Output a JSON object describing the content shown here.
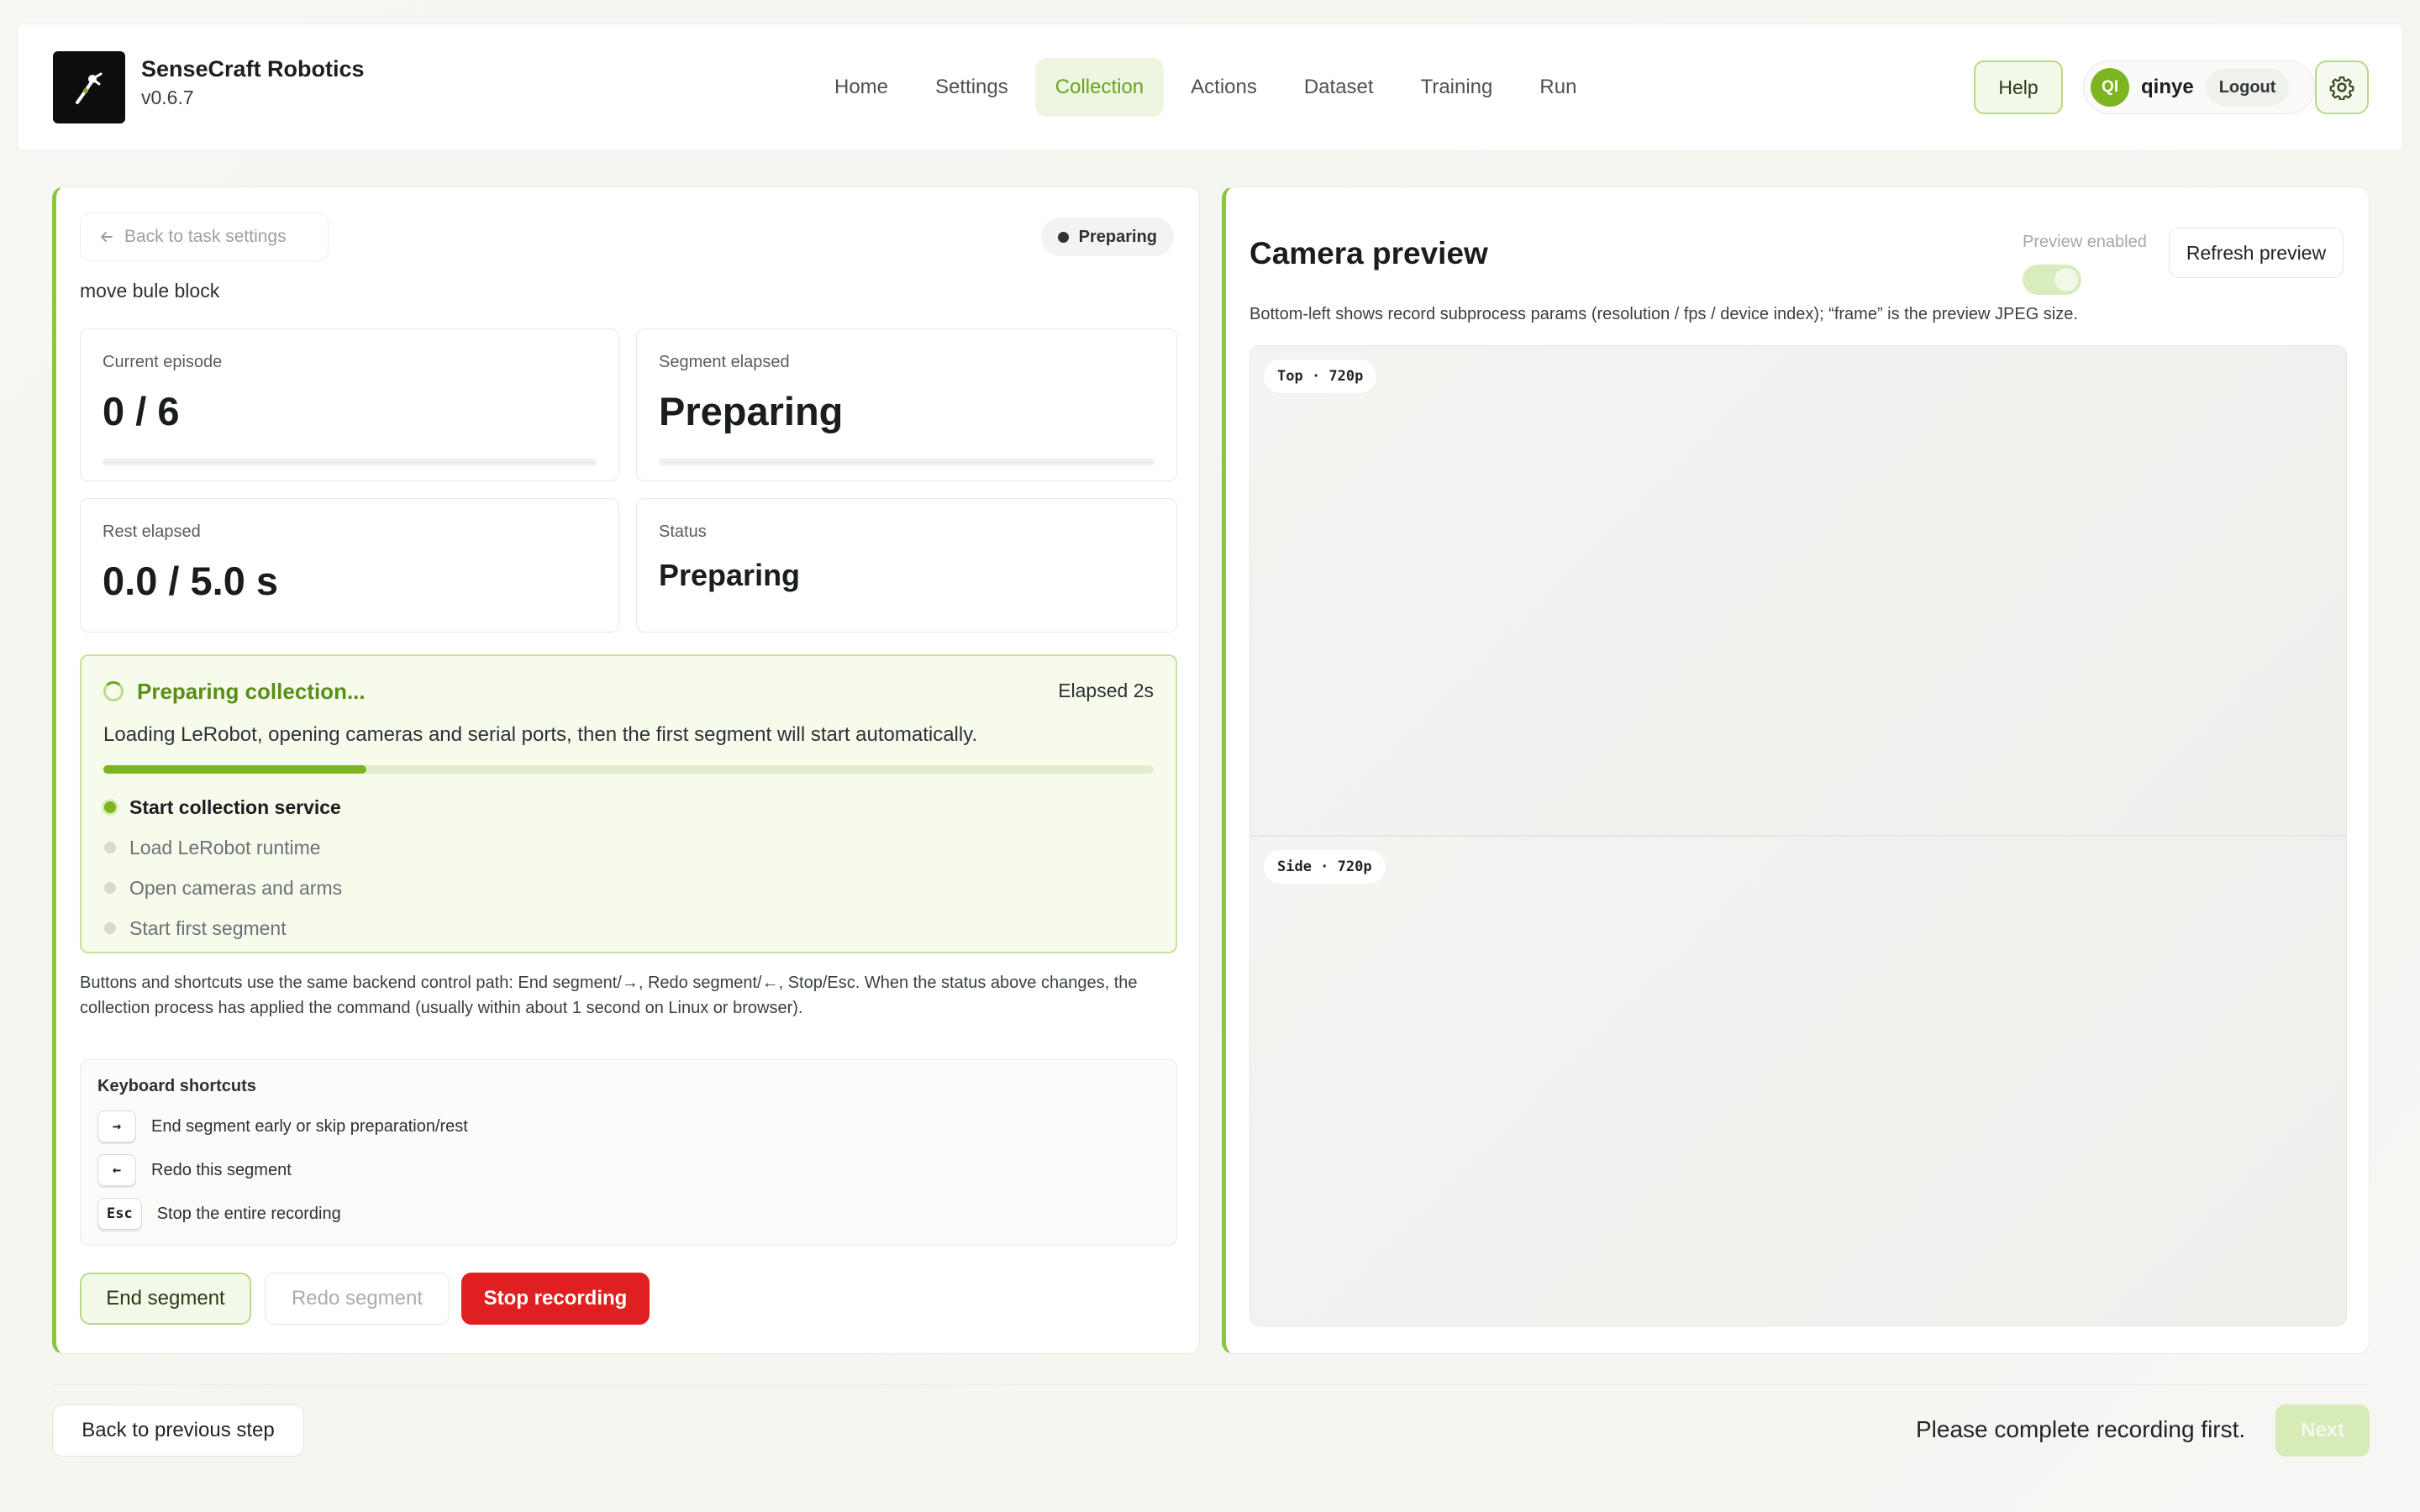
{
  "brand": {
    "name": "SenseCraft Robotics",
    "version": "v0.6.7"
  },
  "nav": {
    "items": [
      "Home",
      "Settings",
      "Collection",
      "Actions",
      "Dataset",
      "Training",
      "Run"
    ],
    "active": "Collection"
  },
  "header": {
    "help_label": "Help",
    "avatar_initials": "QI",
    "username": "qinye",
    "logout_label": "Logout"
  },
  "collection": {
    "back_label": "Back to task settings",
    "status_badge": "Preparing",
    "task_name": "move bule block",
    "cards": {
      "episode_label": "Current episode",
      "episode_value": "0 / 6",
      "segment_label": "Segment elapsed",
      "segment_value": "Preparing",
      "rest_label": "Rest elapsed",
      "rest_value": "0.0 / 5.0 s",
      "status_label": "Status",
      "status_value": "Preparing"
    },
    "prep": {
      "title": "Preparing collection...",
      "elapsed": "Elapsed 2s",
      "description": "Loading LeRobot, opening cameras and serial ports, then the first segment will start automatically.",
      "progress": 0.25,
      "steps": [
        "Start collection service",
        "Load LeRobot runtime",
        "Open cameras and arms",
        "Start first segment"
      ]
    },
    "help_note": "Buttons and shortcuts use the same backend control path: End segment/→, Redo segment/←, Stop/Esc. When the status above changes, the collection process has applied the command (usually within about 1 second on Linux or browser).",
    "shortcuts": {
      "title": "Keyboard shortcuts",
      "items": [
        {
          "key": "→",
          "label": "End segment early or skip preparation/rest"
        },
        {
          "key": "←",
          "label": "Redo this segment"
        },
        {
          "key": "Esc",
          "label": "Stop the entire recording"
        }
      ]
    },
    "buttons": {
      "end": "End segment",
      "redo": "Redo segment",
      "stop": "Stop recording"
    }
  },
  "camera": {
    "title": "Camera preview",
    "preview_enabled_label": "Preview enabled",
    "refresh_label": "Refresh preview",
    "description": "Bottom-left shows record subprocess params (resolution / fps / device index); “frame” is the preview JPEG size.",
    "top_tag": "Top · 720p",
    "side_tag": "Side · 720p"
  },
  "footer": {
    "back_label": "Back to previous step",
    "message": "Please complete recording first.",
    "next_label": "Next"
  },
  "colors": {
    "accent": "#7cb521",
    "danger": "#e02020"
  }
}
